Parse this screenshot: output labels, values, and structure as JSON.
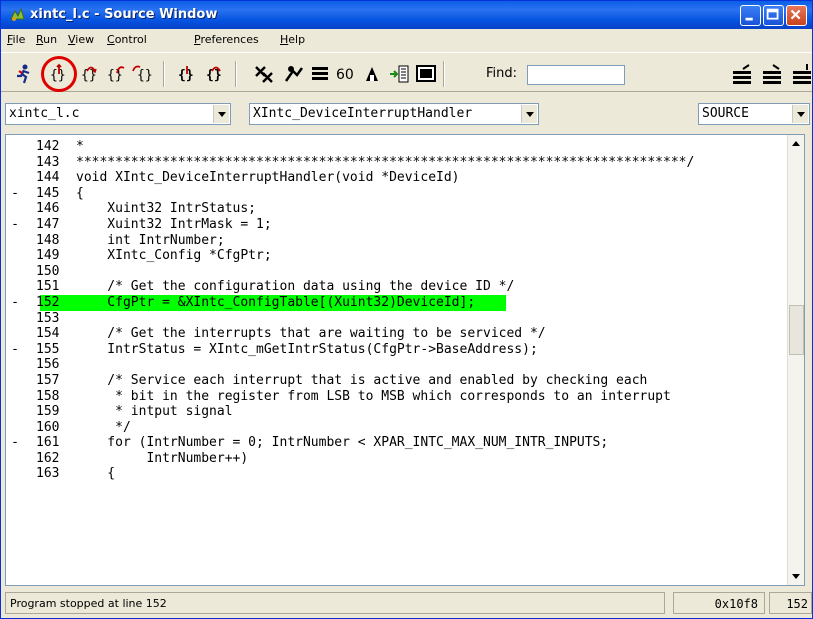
{
  "window": {
    "title": "xintc_l.c - Source Window"
  },
  "menu": [
    {
      "label": "File",
      "accel": "F",
      "rest": "ile"
    },
    {
      "label": "Run",
      "accel": "R",
      "rest": "un"
    },
    {
      "label": "View",
      "accel": "V",
      "rest": "iew"
    },
    {
      "label": "Control",
      "accel": "C",
      "rest": "ontrol"
    },
    {
      "label": "Preferences",
      "accel": "P",
      "rest": "references"
    },
    {
      "label": "Help",
      "accel": "H",
      "rest": "elp"
    }
  ],
  "toolbar": {
    "find_label": "Find:",
    "find_value": ""
  },
  "selectors": {
    "file": "xintc_l.c",
    "function": "XIntc_DeviceInterruptHandler",
    "mode": "SOURCE"
  },
  "source": {
    "current_line": 152,
    "lines": [
      {
        "marker": "",
        "num": "142",
        "text": "*"
      },
      {
        "marker": "",
        "num": "143",
        "text": "******************************************************************************/"
      },
      {
        "marker": "",
        "num": "144",
        "text": "void XIntc_DeviceInterruptHandler(void *DeviceId)"
      },
      {
        "marker": "-",
        "num": "145",
        "text": "{"
      },
      {
        "marker": "",
        "num": "146",
        "text": "    Xuint32 IntrStatus;"
      },
      {
        "marker": "-",
        "num": "147",
        "text": "    Xuint32 IntrMask = 1;"
      },
      {
        "marker": "",
        "num": "148",
        "text": "    int IntrNumber;"
      },
      {
        "marker": "",
        "num": "149",
        "text": "    XIntc_Config *CfgPtr;"
      },
      {
        "marker": "",
        "num": "150",
        "text": ""
      },
      {
        "marker": "",
        "num": "151",
        "text": "    /* Get the configuration data using the device ID */"
      },
      {
        "marker": "-",
        "num": "152",
        "text": "    CfgPtr = &XIntc_ConfigTable[(Xuint32)DeviceId];"
      },
      {
        "marker": "",
        "num": "153",
        "text": ""
      },
      {
        "marker": "",
        "num": "154",
        "text": "    /* Get the interrupts that are waiting to be serviced */"
      },
      {
        "marker": "-",
        "num": "155",
        "text": "    IntrStatus = XIntc_mGetIntrStatus(CfgPtr->BaseAddress);"
      },
      {
        "marker": "",
        "num": "156",
        "text": ""
      },
      {
        "marker": "",
        "num": "157",
        "text": "    /* Service each interrupt that is active and enabled by checking each"
      },
      {
        "marker": "",
        "num": "158",
        "text": "     * bit in the register from LSB to MSB which corresponds to an interrupt"
      },
      {
        "marker": "",
        "num": "159",
        "text": "     * intput signal"
      },
      {
        "marker": "",
        "num": "160",
        "text": "     */"
      },
      {
        "marker": "-",
        "num": "161",
        "text": "    for (IntrNumber = 0; IntrNumber < XPAR_INTC_MAX_NUM_INTR_INPUTS;"
      },
      {
        "marker": "",
        "num": "162",
        "text": "         IntrNumber++)"
      },
      {
        "marker": "",
        "num": "163",
        "text": "    {"
      }
    ]
  },
  "status": {
    "message": "Program stopped at line 152",
    "address": "0x10f8",
    "line": "152"
  },
  "colors": {
    "title_bar": "#0a5ee6",
    "current_line_highlight": "#00ff00",
    "annotation_ring": "#e00000"
  }
}
